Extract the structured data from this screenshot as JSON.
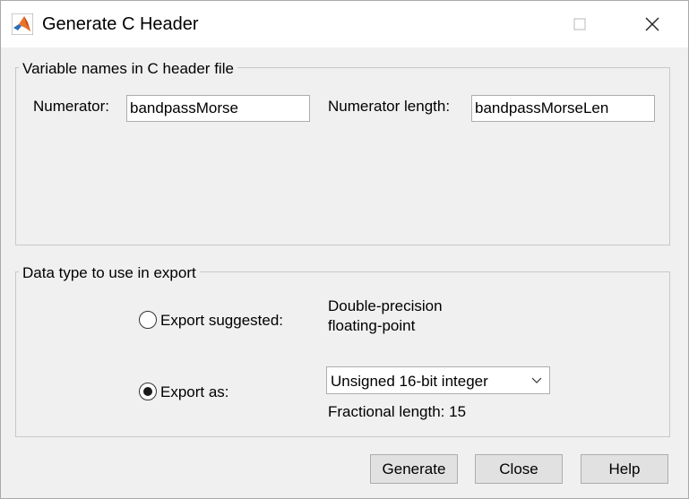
{
  "window": {
    "title": "Generate C Header"
  },
  "variables_group": {
    "label": "Variable names in C header file",
    "numerator_label": "Numerator:",
    "numerator_value": "bandpassMorse",
    "numerator_length_label": "Numerator length:",
    "numerator_length_value": "bandpassMorseLen"
  },
  "datatype_group": {
    "label": "Data type to use in export",
    "export_suggested_label": "Export suggested:",
    "suggested_type_line1": "Double-precision",
    "suggested_type_line2": "floating-point",
    "export_as_label": "Export as:",
    "export_as_selected": "Unsigned 16-bit integer",
    "fractional_length_text": "Fractional length: 15",
    "selected_option": "export_as"
  },
  "buttons": {
    "generate": "Generate",
    "close": "Close",
    "help": "Help"
  },
  "icons": {
    "app": "matlab-logo-icon",
    "maximize": "maximize-icon",
    "close": "close-icon",
    "dropdown": "chevron-down-icon"
  }
}
